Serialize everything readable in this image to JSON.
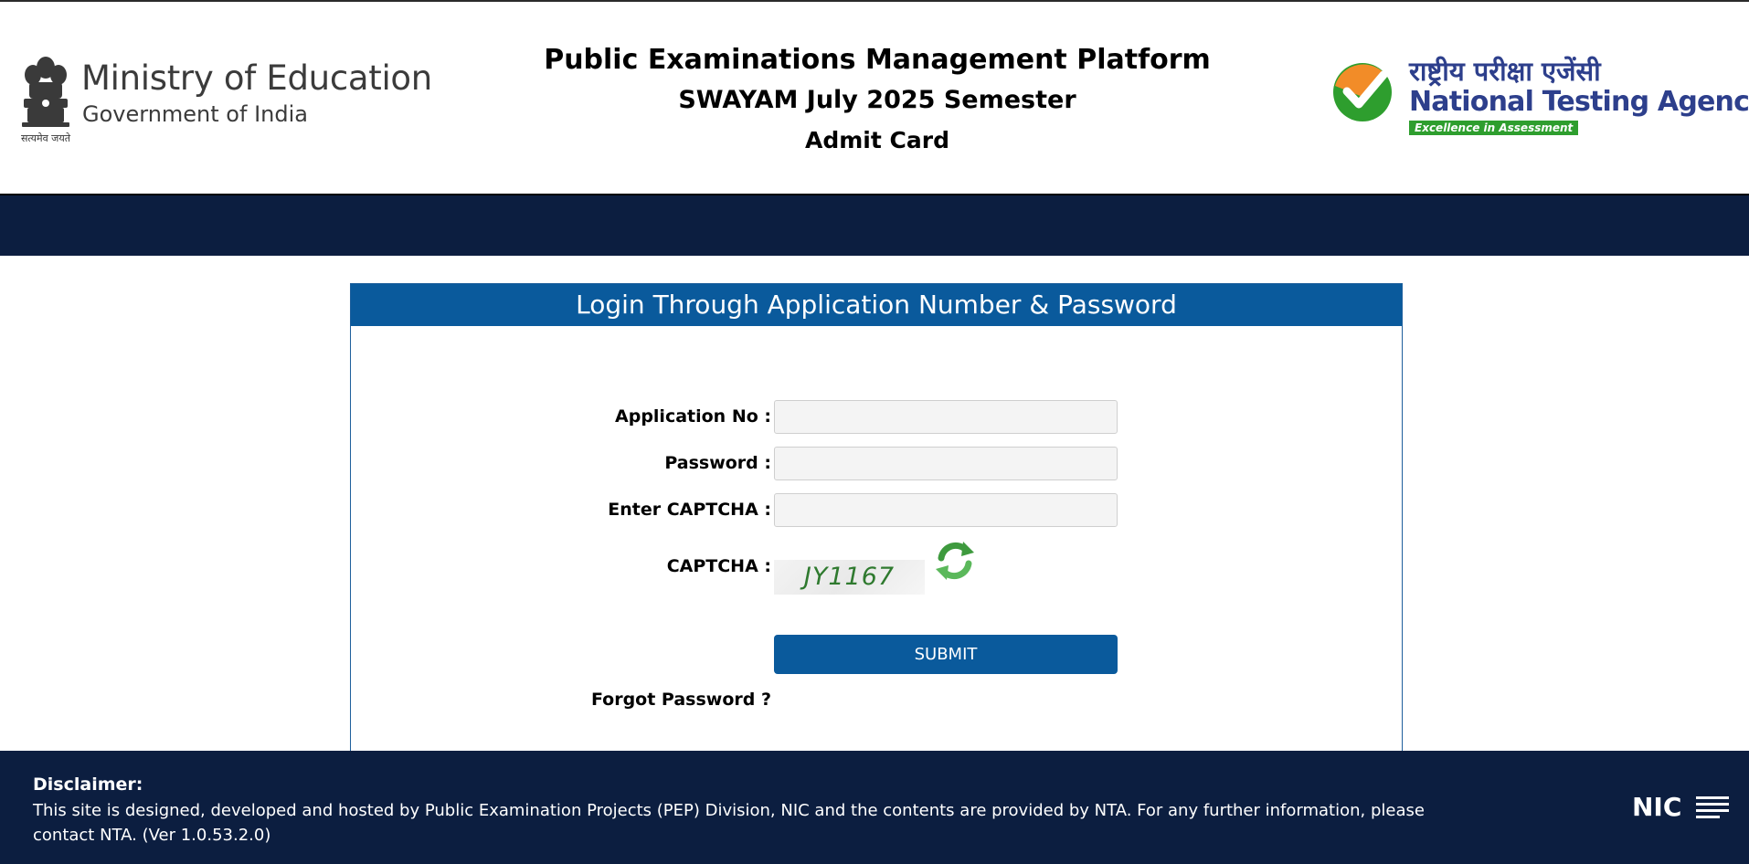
{
  "header": {
    "ministry_title": "Ministry of Education",
    "ministry_subtitle": "Government of India",
    "emblem_motto": "सत्यमेव जयते",
    "title_line1": "Public Examinations Management Platform",
    "title_line2": "SWAYAM July 2025 Semester",
    "title_line3": "Admit Card",
    "agency_hindi": "राष्ट्रीय परीक्षा एजेंसी",
    "agency_english": "National Testing Agency",
    "agency_tagline": "Excellence in Assessment"
  },
  "login": {
    "heading": "Login Through Application Number & Password",
    "application_label": "Application No :",
    "application_value": "",
    "password_label": "Password :",
    "password_value": "",
    "captcha_input_label": "Enter CAPTCHA :",
    "captcha_input_value": "",
    "captcha_label": "CAPTCHA :",
    "captcha_text": "JY1167",
    "submit_label": "SUBMIT",
    "forgot_label": "Forgot Password ?"
  },
  "footer": {
    "disclaimer_title": "Disclaimer:",
    "disclaimer_text": "This site is designed, developed and hosted by Public Examination Projects (PEP) Division, NIC and the contents are provided by NTA. For any further information, please contact NTA. (Ver 1.0.53.2.0)",
    "nic_logo_text": "NIC"
  },
  "colors": {
    "navy": "#0c1e40",
    "panel_blue": "#0a5a9c",
    "nta_blue": "#2d3f8c",
    "nta_green": "#2e9e2e",
    "nta_orange": "#f28c28"
  },
  "icons": {
    "emblem": "ashoka-emblem-icon",
    "nta_logo": "nta-check-logo-icon",
    "refresh": "refresh-icon",
    "nic_logo": "nic-logo-icon"
  }
}
